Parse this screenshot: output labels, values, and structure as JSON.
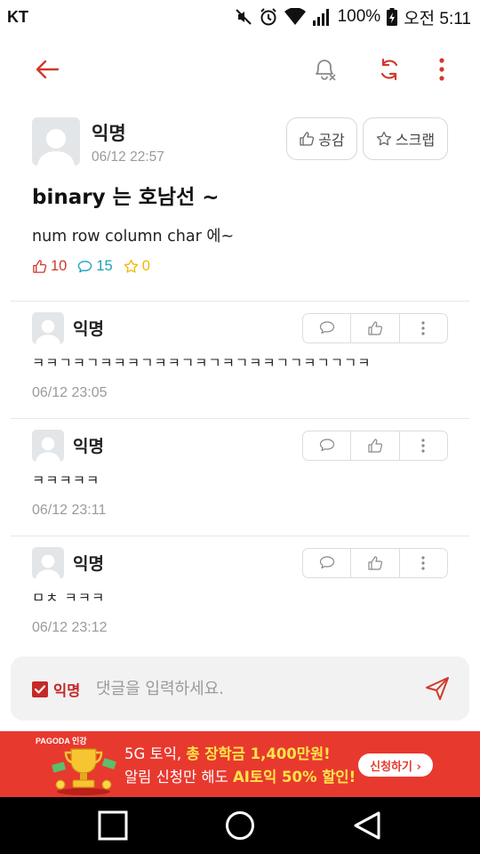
{
  "status_bar": {
    "carrier": "KT",
    "battery": "100%",
    "time": "오전 5:11"
  },
  "app_bar": {
    "back_icon": "arrow-left-icon",
    "notify_icon": "bell-off-icon",
    "refresh_icon": "refresh-icon",
    "more_icon": "more-vertical-icon",
    "accent": "#d0392c"
  },
  "post": {
    "author": "익명",
    "date": "06/12 22:57",
    "like_button": "공감",
    "scrap_button": "스크랩",
    "title": "binary 는 호남선 ~",
    "body": "num row column char 에~",
    "likes": "10",
    "comments": "15",
    "scraps": "0",
    "colors": {
      "likes": "#d0392c",
      "comments": "#1aa1b8",
      "scraps": "#f0b800"
    }
  },
  "comments": [
    {
      "author": "익명",
      "text": "ㅋㅋㄱㅋㄱㅋㅋㅋㄱㅋㅋㄱㅋㄱㅋㄱㅋㅋㄱㄱㅋㄱㄱㄱㅋ",
      "date": "06/12 23:05"
    },
    {
      "author": "익명",
      "text": "ㅋㅋㅋㅋㅋ",
      "date": "06/12 23:11"
    },
    {
      "author": "익명",
      "text": "ㅁㅊ ㅋㅋㅋ",
      "date": "06/12 23:12"
    }
  ],
  "composer": {
    "anonymous_label": "익명",
    "anonymous_checked": true,
    "placeholder": "댓글을 입력하세요."
  },
  "ad": {
    "brand": "PAGODA 인강",
    "line1_prefix": "5G 토익, ",
    "line1_highlight": "총 장학금 1,400만원!",
    "line2_prefix": "알림 신청만 해도 ",
    "line2_highlight": "AI토익 50% 할인!",
    "cta": "신청하기 ›",
    "bg_color": "#e8392f"
  }
}
